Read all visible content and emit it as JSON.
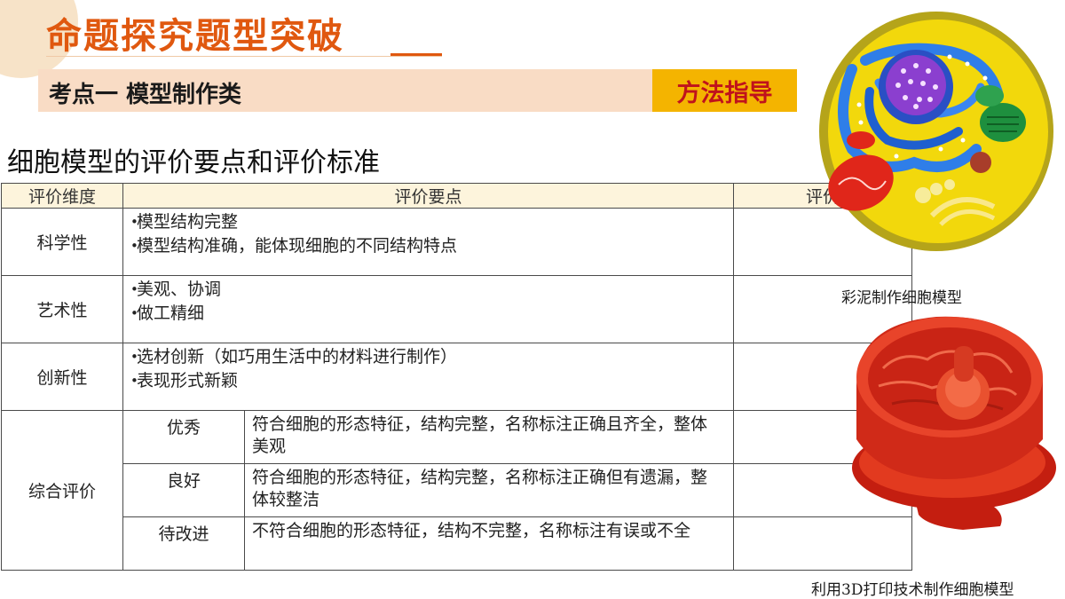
{
  "header": {
    "title": "命题探究题型突破",
    "subtitle": "考点一  模型制作类",
    "badge": "方法指导"
  },
  "section_heading": "细胞模型的评价要点和评价标准",
  "table": {
    "headers": [
      "评价维度",
      "评价要点",
      "评价"
    ],
    "rows": [
      {
        "dimension": "科学性",
        "points": [
          "模型结构完整",
          "模型结构准确，能体现细胞的不同结构特点"
        ]
      },
      {
        "dimension": "艺术性",
        "points": [
          "美观、协调",
          "做工精细"
        ]
      },
      {
        "dimension": "创新性",
        "points": [
          "选材创新（如巧用生活中的材料进行制作）",
          "表现形式新颖"
        ]
      }
    ],
    "overall": {
      "dimension": "综合评价",
      "grades": [
        {
          "grade": "优秀",
          "description": "符合细胞的形态特征，结构完整，名称标注正确且齐全，整体美观"
        },
        {
          "grade": "良好",
          "description": "符合细胞的形态特征，结构完整，名称标注正确但有遗漏，整体较整洁"
        },
        {
          "grade": "待改进",
          "description": "不符合细胞的形态特征，结构不完整，名称标注有误或不全"
        }
      ]
    }
  },
  "photos": [
    {
      "caption": "彩泥制作细胞模型",
      "icon": "clay-cell-model-image"
    },
    {
      "caption": "利用3D打印技术制作细胞模型",
      "icon": "3d-printed-cell-model-image"
    }
  ],
  "colors": {
    "title": "#e0580f",
    "subbar": "#f9dcc5",
    "badge_bg": "#f4b400",
    "badge_text": "#c0121c",
    "table_header_bg": "#fdf4dc",
    "model_red": "#d6281b"
  }
}
